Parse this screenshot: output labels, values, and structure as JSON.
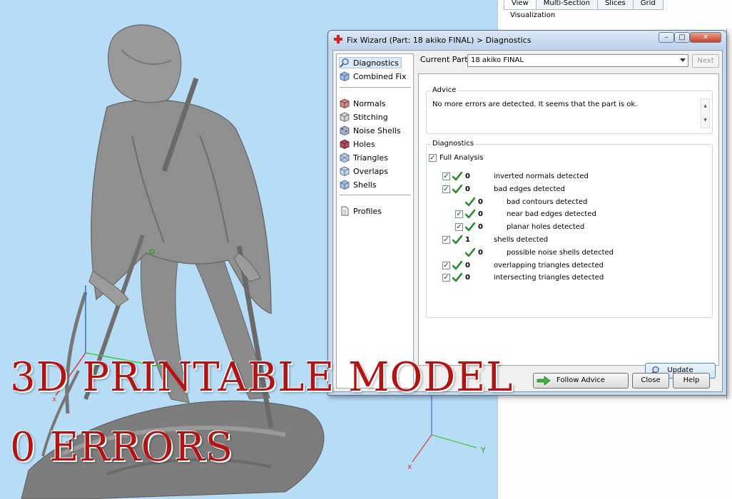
{
  "right_panel": {
    "tabs": [
      {
        "label": "View",
        "active": true
      },
      {
        "label": "Multi-Section",
        "active": false
      },
      {
        "label": "Slices",
        "active": false
      },
      {
        "label": "Grid",
        "active": false
      }
    ],
    "section_label": "Visualization"
  },
  "viewport": {
    "axis_label": "Y"
  },
  "overlay": {
    "line1": "3D PRINTABLE MODEL",
    "line2": "0 ERRORS",
    "color": "#b01515"
  },
  "dialog": {
    "title": "Fix Wizard (Part: 18 akiko FINAL) > Diagnostics",
    "title_icon": "red-cross-icon",
    "window_buttons": {
      "minimize": "–",
      "maximize": "□",
      "close": "✕"
    },
    "nav": [
      {
        "label": "Diagnostics",
        "icon": "magnifier-icon",
        "selected": true
      },
      {
        "label": "Combined Fix",
        "icon": "cube-icon"
      },
      {
        "label": "Normals",
        "icon": "cube-icon"
      },
      {
        "label": "Stitching",
        "icon": "cube-icon"
      },
      {
        "label": "Noise Shells",
        "icon": "cube-icon"
      },
      {
        "label": "Holes",
        "icon": "cube-icon"
      },
      {
        "label": "Triangles",
        "icon": "cube-icon"
      },
      {
        "label": "Overlaps",
        "icon": "cube-icon"
      },
      {
        "label": "Shells",
        "icon": "cube-icon"
      },
      {
        "label": "Profiles",
        "icon": "document-icon"
      }
    ],
    "current_part_label": "Current Part:",
    "current_part_value": "18 akiko FINAL",
    "next_label": "Next",
    "advice": {
      "title": "Advice",
      "text": "No more errors are detected. It seems that the part is ok."
    },
    "diagnostics": {
      "title": "Diagnostics",
      "full_analysis_label": "Full Analysis",
      "rows": [
        {
          "count": "0",
          "label": "inverted normals detected",
          "checkbox": true,
          "level": 0
        },
        {
          "count": "0",
          "label": "bad edges detected",
          "checkbox": true,
          "level": 0
        },
        {
          "count": "0",
          "label": "bad contours detected",
          "checkbox": false,
          "level": 1
        },
        {
          "count": "0",
          "label": "near bad edges detected",
          "checkbox": true,
          "level": 1
        },
        {
          "count": "0",
          "label": "planar holes detected",
          "checkbox": true,
          "level": 1
        },
        {
          "count": "1",
          "label": "shells detected",
          "checkbox": true,
          "level": 0
        },
        {
          "count": "0",
          "label": "possible noise shells detected",
          "checkbox": false,
          "level": 1
        },
        {
          "count": "0",
          "label": "overlapping triangles detected",
          "checkbox": true,
          "level": 0
        },
        {
          "count": "0",
          "label": "intersecting triangles detected",
          "checkbox": true,
          "level": 0
        }
      ],
      "update_label": "Update"
    },
    "buttons": {
      "follow_advice": "Follow Advice",
      "close": "Close",
      "help": "Help"
    },
    "colors": {
      "check": "#2b8a2b",
      "accent": "#4b87c5"
    }
  }
}
